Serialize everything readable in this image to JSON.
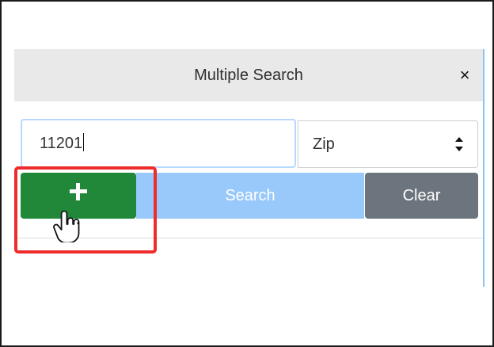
{
  "dialog": {
    "title": "Multiple Search",
    "close_icon": "close-icon",
    "close_symbol": "×"
  },
  "search": {
    "input_value": "11201",
    "select_value": "Zip",
    "select_icon": "sort-arrows-icon"
  },
  "buttons": {
    "add_icon": "plus-icon",
    "search_label": "Search",
    "clear_label": "Clear"
  },
  "overlay": {
    "cursor_icon": "hand-cursor-icon",
    "highlight_color": "#ee2c2c"
  },
  "colors": {
    "header_background": "#e9e9e9",
    "add_button": "#21883a",
    "search_button": "#99c9fb",
    "clear_button": "#6c757d",
    "input_focus_border": "#b8d8ff"
  }
}
